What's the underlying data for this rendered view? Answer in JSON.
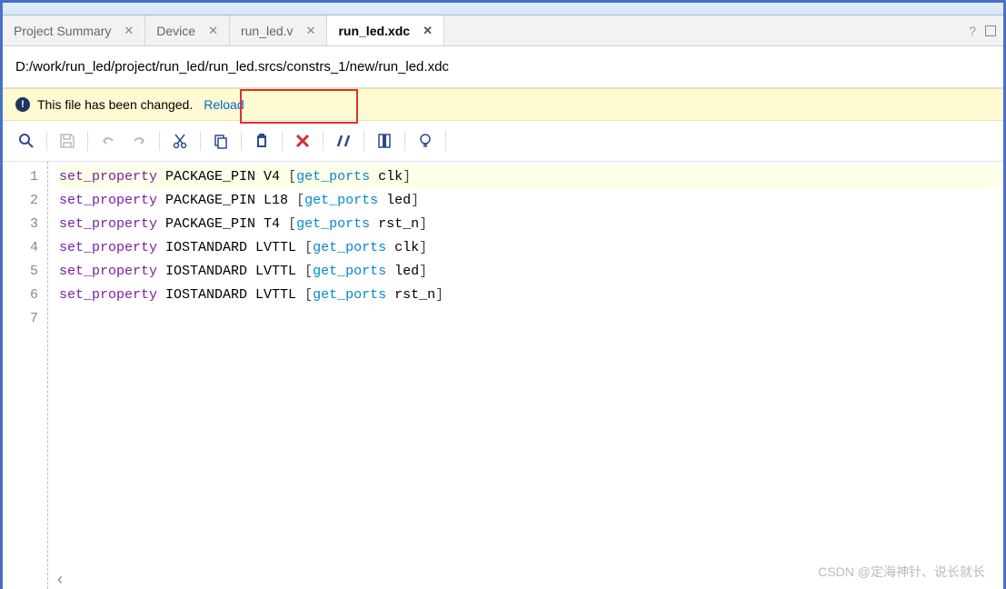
{
  "tabs": [
    {
      "label": "Project Summary"
    },
    {
      "label": "Device"
    },
    {
      "label": "run_led.v"
    },
    {
      "label": "run_led.xdc"
    }
  ],
  "active_tab_index": 3,
  "file_path": "D:/work/run_led/project/run_led/run_led.srcs/constrs_1/new/run_led.xdc",
  "notification": {
    "text": "This file has been changed.",
    "link": "Reload"
  },
  "code": [
    {
      "num": "1",
      "cmd": "set_property",
      "prop": "PACKAGE_PIN",
      "val": "V4",
      "get": "get_ports",
      "port": "clk",
      "hl": true
    },
    {
      "num": "2",
      "cmd": "set_property",
      "prop": "PACKAGE_PIN",
      "val": "L18",
      "get": "get_ports",
      "port": "led",
      "hl": false
    },
    {
      "num": "3",
      "cmd": "set_property",
      "prop": "PACKAGE_PIN",
      "val": "T4",
      "get": "get_ports",
      "port": "rst_n",
      "hl": false
    },
    {
      "num": "4",
      "cmd": "set_property",
      "prop": "IOSTANDARD",
      "val": "LVTTL",
      "get": "get_ports",
      "port": "clk",
      "hl": false
    },
    {
      "num": "5",
      "cmd": "set_property",
      "prop": "IOSTANDARD",
      "val": "LVTTL",
      "get": "get_ports",
      "port": "led",
      "hl": false
    },
    {
      "num": "6",
      "cmd": "set_property",
      "prop": "IOSTANDARD",
      "val": "LVTTL",
      "get": "get_ports",
      "port": "rst_n",
      "hl": false
    }
  ],
  "empty_line": "7",
  "watermark": "CSDN @定海神针、说长就长"
}
